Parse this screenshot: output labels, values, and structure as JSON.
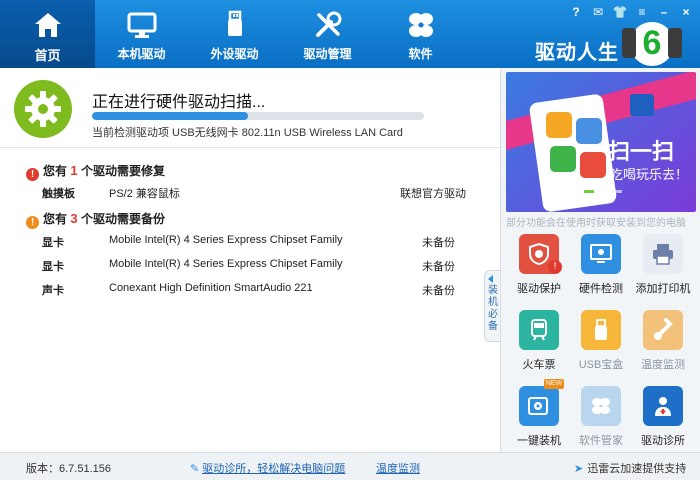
{
  "nav": {
    "items": [
      {
        "label": "首页",
        "icon": "home-icon"
      },
      {
        "label": "本机驱动",
        "icon": "monitor-icon"
      },
      {
        "label": "外设驱动",
        "icon": "usb-icon"
      },
      {
        "label": "驱动管理",
        "icon": "tools-icon"
      },
      {
        "label": "软件",
        "icon": "apps-icon"
      }
    ],
    "active": 0
  },
  "brand": {
    "title": "驱动人生",
    "logo_number": "6"
  },
  "window_controls": {
    "help": "?",
    "message": "✉",
    "skin": "👕",
    "menu": "≡",
    "minimize": "–",
    "close": "×"
  },
  "scan": {
    "title": "正在进行硬件驱动扫描...",
    "progress": 0.47,
    "subtitle": "当前检测驱动项 USB无线网卡 802.11n USB Wireless LAN Card"
  },
  "repair": {
    "prefix": "您有",
    "count": "1",
    "suffix": "个驱动需要修复",
    "items": [
      {
        "type": "触摸板",
        "name": "PS/2 兼容鼠标",
        "status": "联想官方驱动"
      }
    ]
  },
  "backup": {
    "prefix": "您有",
    "count": "3",
    "suffix": "个驱动需要备份",
    "items": [
      {
        "type": "显卡",
        "name": "Mobile Intel(R) 4 Series Express Chipset Family",
        "status": "未备份"
      },
      {
        "type": "显卡",
        "name": "Mobile Intel(R) 4 Series Express Chipset Family",
        "status": "未备份"
      },
      {
        "type": "声卡",
        "name": "Conexant High Definition SmartAudio 221",
        "status": "未备份"
      }
    ]
  },
  "side_tab": {
    "label": "装机必备"
  },
  "banner": {
    "headline": "扫一扫",
    "tagline": "吃喝玩乐去！"
  },
  "ticker": "部分功能会在使用时获取安装到您的电脑",
  "tools": [
    {
      "label": "驱动保护",
      "icon": "shield-gear-icon",
      "color": "#e2503f"
    },
    {
      "label": "硬件检测",
      "icon": "monitor-check-icon",
      "color": "#2f8fe0"
    },
    {
      "label": "添加打印机",
      "icon": "printer-icon",
      "color": "#6b7fa8"
    },
    {
      "label": "火车票",
      "icon": "train-icon",
      "color": "#2bb5a0"
    },
    {
      "label": "USB宝盒",
      "icon": "usb-box-icon",
      "color": "#f5a623"
    },
    {
      "label": "温度监测",
      "icon": "thermometer-icon",
      "color": "#f08c1a"
    },
    {
      "label": "一键装机",
      "icon": "disc-icon",
      "color": "#2f8fe0",
      "badge": "NEW"
    },
    {
      "label": "软件管家",
      "icon": "flower-icon",
      "color": "#8fc0e8"
    },
    {
      "label": "驱动诊所",
      "icon": "doctor-icon",
      "color": "#1e6fc8"
    }
  ],
  "footer": {
    "version": "版本：6.7.51.156",
    "diag_link": "驱动诊所，轻松解决电脑问题",
    "temp_link": "温度监测",
    "xunlei": "迅雷云加速提供支持"
  }
}
